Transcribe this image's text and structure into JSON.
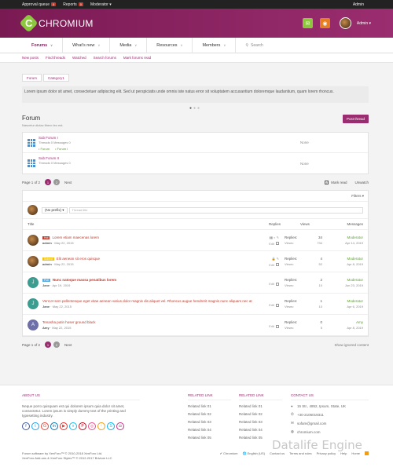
{
  "topbar": {
    "items": [
      {
        "label": "Approval queue",
        "badge": "0"
      },
      {
        "label": "Reports",
        "badge": "0"
      },
      {
        "label": "Moderator ▾",
        "badge": ""
      }
    ],
    "admin": "Admin"
  },
  "header": {
    "logo_letter": "C",
    "logo_text": "CHROMIUM",
    "user": "Admin ▾",
    "colors": {
      "gradient_start": "#7a1a53",
      "gradient_end": "#9a2d6f",
      "logo": "#8dc63f"
    }
  },
  "nav": {
    "tabs": [
      "Forums",
      "What's new",
      "Media",
      "Resources",
      "Members"
    ],
    "search": "Search"
  },
  "subnav": [
    "New posts",
    "Find threads",
    "Watched",
    "Search forums",
    "Mark forums read"
  ],
  "breadcrumb": [
    "Forum",
    "Category1"
  ],
  "notice": "Lorem ipsum dolor sit amet, consectetuer adipiscing elit. Sed ut perspiciatis unde omnis iste natus error sit voluptatem accusantium doloremque laudantium, quam lorem rhoncus.",
  "forum": {
    "title": "Forum",
    "description": "Nascetur dictac libero leo est.",
    "post_button": "Post thread"
  },
  "subforums": [
    {
      "name": "Sub Forum I",
      "stats": "Threads  0     Messages  0",
      "links": [
        "• Forum",
        "• Forum I"
      ],
      "last": "None"
    },
    {
      "name": "Sub Forum II",
      "stats": "Threads  0     Messages  0",
      "links": [],
      "last": "None"
    }
  ],
  "pager": {
    "label": "Page 1 of 2",
    "pages": [
      "1",
      "2"
    ],
    "next": "Next",
    "mark_read": "Mark read",
    "unwatch": "Unwatch",
    "show_ignored": "Show ignored content"
  },
  "threads": {
    "filters": "Filters ▾",
    "prefix": "(No prefix) ▾",
    "title_placeholder": "Thread title",
    "columns": {
      "title": "Title",
      "replies": "Replies",
      "views": "Views",
      "messages": "Messages"
    },
    "rows": [
      {
        "prefix": "Hot",
        "prefix_color": "#c0392b",
        "title": "Lorem etiam maecenas lorem",
        "author": "admin",
        "date": "May 22, 2015",
        "status_icons": "▮▮ ◐ ✎",
        "select": "Edit",
        "replies": "34",
        "views": "734",
        "last_user": "Moderator",
        "last_date": "Apr 14, 2019",
        "avatar": "img",
        "avatar_letter": "",
        "avatar_color": "",
        "bold": false
      },
      {
        "prefix": "Solved",
        "prefix_color": "#f1c40f",
        "title": "Elit aenean sit eros quisque",
        "author": "admin",
        "date": "May 22, 2015",
        "status_icons": "🔒 ✎",
        "select": "Edit",
        "replies": "4",
        "views": "52",
        "last_user": "Moderator",
        "last_date": "Apr 8, 2019",
        "avatar": "img",
        "avatar_letter": "",
        "avatar_color": "",
        "bold": false
      },
      {
        "prefix": "Poll",
        "prefix_color": "#5dade2",
        "title": "Nunc natoque massa penatibus lorem",
        "author": "Jane",
        "date": "Apr 19, 2019",
        "status_icons": "",
        "select": "Edit",
        "replies": "2",
        "views": "10",
        "last_user": "Moderator",
        "last_date": "Jun 23, 2019",
        "avatar": "letter",
        "avatar_letter": "J",
        "avatar_color": "#3a9d8f",
        "bold": true
      },
      {
        "prefix": "",
        "prefix_color": "",
        "title": "Vent et sem pellentesque eget vitae aenean varius dolor magnis dis aliquet vel. Rhoncus augue hendrerit magnis nunc aliquam nec at",
        "author": "Jane",
        "date": "May 22, 2015",
        "status_icons": "",
        "select": "Edit",
        "replies": "1",
        "views": "10",
        "last_user": "Moderator",
        "last_date": "Apr 6, 2019",
        "avatar": "letter",
        "avatar_letter": "J",
        "avatar_color": "#3a9d8f",
        "bold": false
      },
      {
        "prefix": "",
        "prefix_color": "",
        "title": "Tenasha putin hoser ground black",
        "author": "Amy",
        "date": "May 22, 2015",
        "status_icons": "",
        "select": "Edit",
        "replies": "0",
        "views": "5",
        "last_user": "Amy",
        "last_date": "Apr 8, 2019",
        "avatar": "letter",
        "avatar_letter": "A",
        "avatar_color": "#6c6fa8",
        "bold": false
      }
    ],
    "stat_labels": {
      "replies": "Replies:",
      "views": "Views:"
    }
  },
  "footer": {
    "about_title": "ABOUT US",
    "about_text": "Neque porro quisquam est qui dolorem ipsum quia dolor sit amet, consectetur. Lorem ipsum is simply dummy text of the printing and typesetting industry.",
    "related1_title": "RELATED LINK",
    "related1": [
      "Related link 01",
      "Related link 02",
      "Related link 03",
      "Related link 04",
      "Related link 05"
    ],
    "related2_title": "RELATED LINK",
    "related2": [
      "Related link 01",
      "Related link 02",
      "Related link 03",
      "Related link 04",
      "Related link 05"
    ],
    "contact_title": "CONTACT US",
    "contact": [
      {
        "icon": "⌖",
        "text": "15 Str., 4852, Ipsum, State, UK"
      },
      {
        "icon": "✆",
        "text": "+30-2106019311"
      },
      {
        "icon": "✉",
        "text": "sofam@gmail.com"
      },
      {
        "icon": "◍",
        "text": "chromium.com"
      }
    ],
    "copyright1": "Forum software by XenForo™ © 2010-2018 XenForo Ltd.",
    "copyright2": "XenForo Add-ons & XenForo Styles™ © 2012-2017 Brivium LLC",
    "links": [
      "✔ Chromium",
      "🌐 English (US)",
      "Contact us",
      "Terms and rules",
      "Privacy policy",
      "Help",
      "Home"
    ]
  },
  "watermark": "Datalife Engine"
}
